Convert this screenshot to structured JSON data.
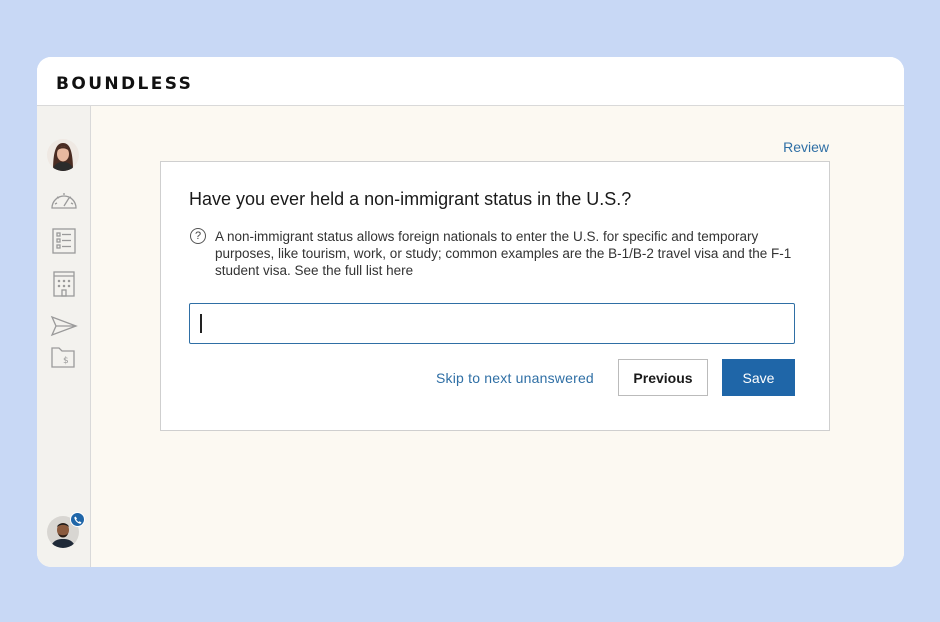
{
  "brand": {
    "logo_text": "BOUNDLESS"
  },
  "sidebar": {
    "items": [
      {
        "icon": "dashboard-gauge-icon"
      },
      {
        "icon": "checklist-icon"
      },
      {
        "icon": "building-icon"
      },
      {
        "icon": "send-icon"
      },
      {
        "icon": "folder-dollar-icon"
      }
    ],
    "support_badge_icon": "phone-icon"
  },
  "main": {
    "review_label": "Review",
    "question": "Have you ever held a non-immigrant status in the U.S.?",
    "help_text": "A non-immigrant status allows foreign nationals to enter the U.S. for specific and temporary purposes, like tourism, work, or study; common examples are the B-1/B-2 travel visa and the F-1 student visa. See the full list here",
    "answer_value": "",
    "skip_label": "Skip to next unanswered",
    "previous_label": "Previous",
    "save_label": "Save"
  },
  "colors": {
    "background": "#c8d8f5",
    "accent": "#1f66a8",
    "link": "#2f6fa5",
    "main_bg": "#fcf9f2",
    "sidebar_bg": "#f3f2ee"
  }
}
